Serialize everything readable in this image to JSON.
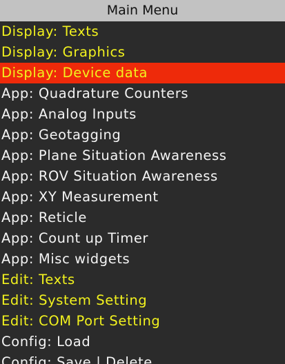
{
  "menu": {
    "title": "Main Menu",
    "items": [
      {
        "label": "Display: Texts",
        "color": "#f2f21e",
        "selected": false
      },
      {
        "label": "Display: Graphics",
        "color": "#f2f21e",
        "selected": false
      },
      {
        "label": "Display: Device data",
        "color": "#f2f21e",
        "selected": true
      },
      {
        "label": "App: Quadrature Counters",
        "color": "#f4f4f4",
        "selected": false
      },
      {
        "label": "App: Analog Inputs",
        "color": "#f4f4f4",
        "selected": false
      },
      {
        "label": "App: Geotagging",
        "color": "#f4f4f4",
        "selected": false
      },
      {
        "label": "App: Plane Situation Awareness",
        "color": "#f4f4f4",
        "selected": false
      },
      {
        "label": "App: ROV Situation Awareness",
        "color": "#f4f4f4",
        "selected": false
      },
      {
        "label": "App: XY Measurement",
        "color": "#f4f4f4",
        "selected": false
      },
      {
        "label": "App: Reticle",
        "color": "#f4f4f4",
        "selected": false
      },
      {
        "label": "App: Count up Timer",
        "color": "#f4f4f4",
        "selected": false
      },
      {
        "label": "App: Misc widgets",
        "color": "#f4f4f4",
        "selected": false
      },
      {
        "label": "Edit: Texts",
        "color": "#f2f21e",
        "selected": false
      },
      {
        "label": "Edit: System Setting",
        "color": "#f2f21e",
        "selected": false
      },
      {
        "label": "Edit: COM Port Setting",
        "color": "#f2f21e",
        "selected": false
      },
      {
        "label": "Config: Load",
        "color": "#f4f4f4",
        "selected": false
      },
      {
        "label": "Config: Save | Delete",
        "color": "#f4f4f4",
        "selected": false
      }
    ]
  },
  "colors": {
    "background": "#2b2b2b",
    "title_bar": "#c2c2c2",
    "highlight": "#ee2a0a",
    "yellow_text": "#f2f21e",
    "white_text": "#f4f4f4"
  }
}
